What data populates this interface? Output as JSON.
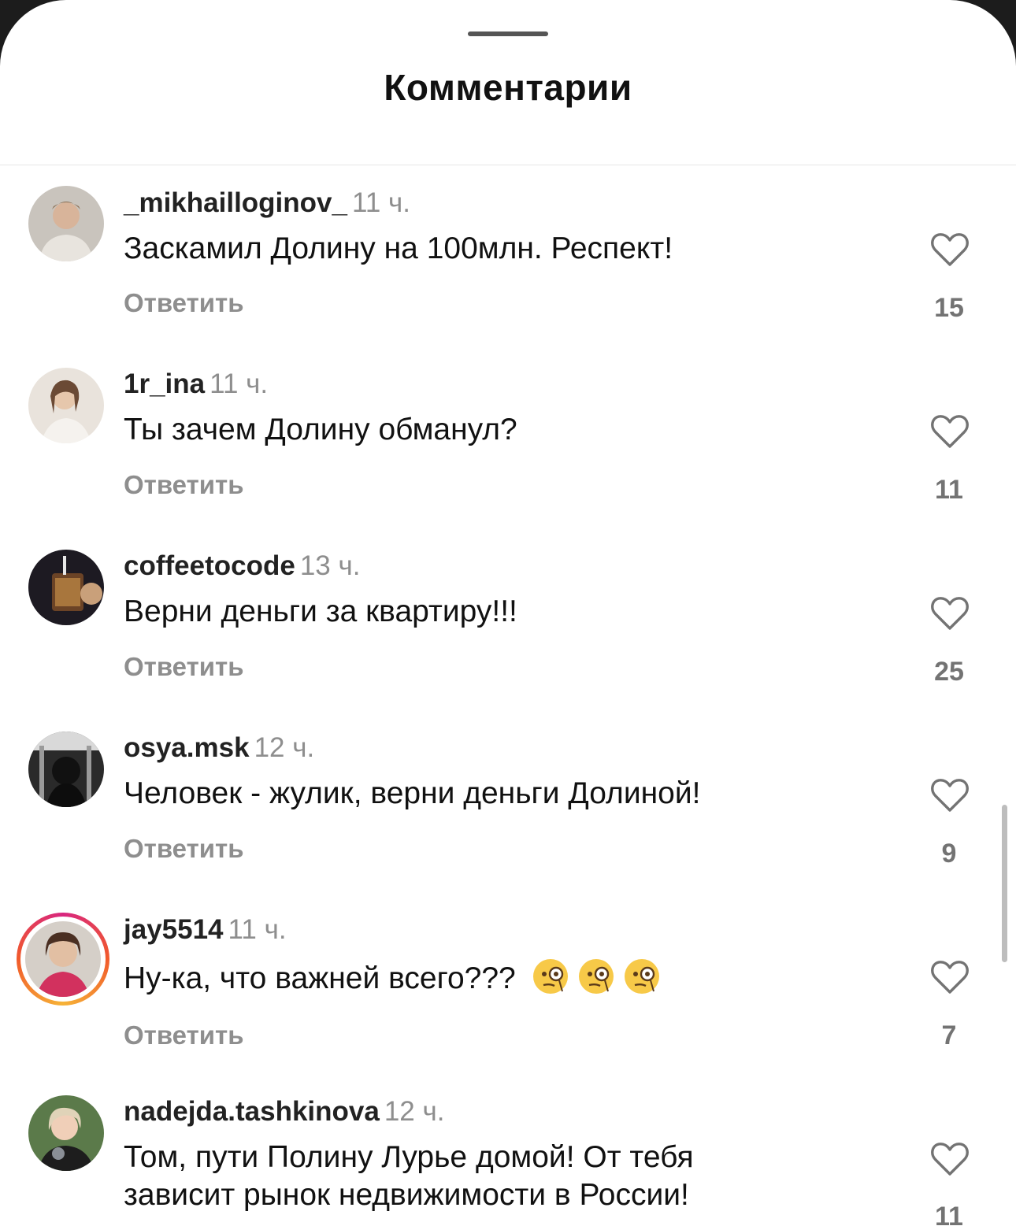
{
  "header": {
    "title": "Комментарии"
  },
  "colors": {
    "username": "#222222",
    "muted": "#8e8e8e",
    "story_ring": "#d8267f"
  },
  "comments": [
    {
      "username": "_mikhailloginov_",
      "time": "11 ч.",
      "text": "Заскамил Долину на 100млн. Респект!",
      "reply": "Ответить",
      "likes": "15"
    },
    {
      "username": "1r_ina",
      "time": "11 ч.",
      "text": "Ты зачем Долину обманул?",
      "reply": "Ответить",
      "likes": "11"
    },
    {
      "username": "coffeetocode",
      "time": "13 ч.",
      "text": "Верни деньги за квартиру!!!",
      "reply": "Ответить",
      "likes": "25"
    },
    {
      "username": "osya.msk",
      "time": "12 ч.",
      "text": "Человек - жулик, верни деньги Долиной!",
      "reply": "Ответить",
      "likes": "9"
    },
    {
      "username": "jay5514",
      "time": "11 ч.",
      "text": "Ну-ка, что важней всего???",
      "emoji": "face-with-monocle-icon x3",
      "reply": "Ответить",
      "likes": "7"
    },
    {
      "username": "nadejda.tashkinova",
      "time": "12 ч.",
      "text_line1": "Том, пути Полину Лурье домой! От тебя",
      "text_line2": "зависит рынок недвижимости в России!",
      "likes": "11"
    }
  ]
}
